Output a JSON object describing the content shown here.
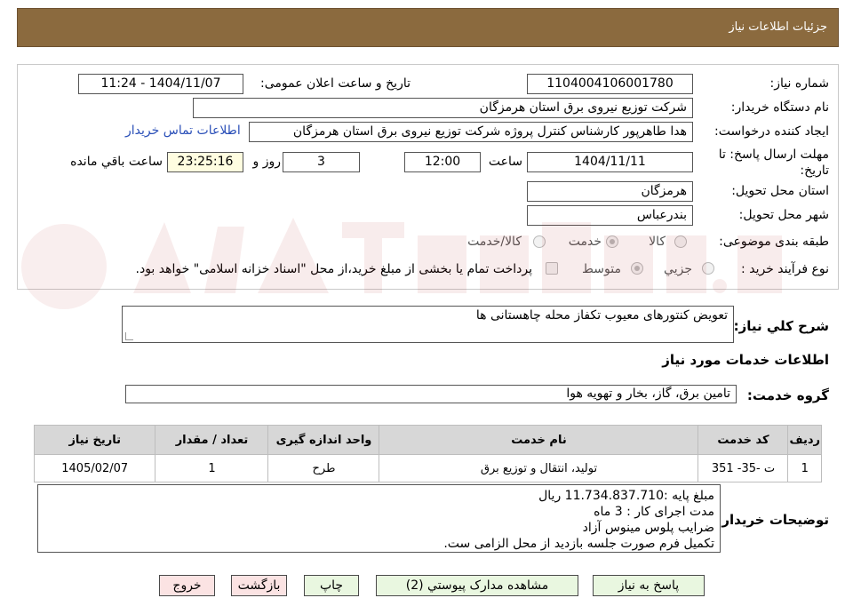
{
  "header": {
    "title": "جزئیات اطلاعات نیاز"
  },
  "form": {
    "need_number_label": "شماره نیاز:",
    "need_number": "1104004106001780",
    "announce_label": "تاریخ و ساعت اعلان عمومی:",
    "announce_value": "1404/11/07 - 11:24",
    "buyer_org_label": "نام دستگاه خریدار:",
    "buyer_org": "شرکت توزیع نیروی برق استان هرمزگان",
    "requester_label": "ایجاد کننده درخواست:",
    "requester": "هدا طاهرپور کارشناس کنترل پروژه شرکت توزیع نیروی برق استان هرمزگان",
    "contact_link": "اطلاعات تماس خریدار",
    "deadline_label_1": "مهلت ارسال پاسخ: تا",
    "deadline_label_2": "تاریخ:",
    "deadline_date": "1404/11/11",
    "time_label": "ساعت",
    "deadline_time": "12:00",
    "days": "3",
    "days_label": "روز و",
    "remaining_time": "23:25:16",
    "remaining_label": "ساعت باقي مانده",
    "province_label": "استان محل تحویل:",
    "province": "هرمزگان",
    "city_label": "شهر محل تحویل:",
    "city": "بندرعباس",
    "category_label": "طبقه بندی موضوعی:",
    "category_options": [
      "کالا",
      "خدمت",
      "کالا/خدمت"
    ],
    "category_selected": "خدمت",
    "process_label": "نوع فرآیند خرید :",
    "process_options": [
      "جزیي",
      "متوسط"
    ],
    "process_selected": "متوسط",
    "payment_note": "پرداخت تمام یا بخشی از مبلغ خرید،از محل \"اسناد خزانه اسلامی\" خواهد بود."
  },
  "summary": {
    "label": "شرح کلي نياز:",
    "text": "تعویض کنتورهای معیوب تکفاز محله چاهستانی ها"
  },
  "services": {
    "title": "اطلاعات خدمات مورد نیاز",
    "group_label": "گروه خدمت:",
    "group_value": "تامین برق، گاز، بخار و تهویه هوا",
    "columns": [
      "ردیف",
      "کد خدمت",
      "نام خدمت",
      "واحد اندازه گیری",
      "تعداد / مقدار",
      "تاریخ نیاز"
    ],
    "rows": [
      [
        "1",
        "ت -35- 351",
        "تولید، انتقال و توزیع برق",
        "طرح",
        "1",
        "1405/02/07"
      ]
    ]
  },
  "buyer_notes": {
    "label": "توضیحات خریدار:",
    "lines": [
      "مبلغ پایه :11.734.837.710 ریال",
      "مدت اجرای کار : 3 ماه",
      "ضرایب پلوس مینوس آزاد",
      "تکمیل فرم صورت جلسه بازدید از محل الزامی ست."
    ]
  },
  "buttons": {
    "reply": "پاسخ به نیاز",
    "attachments": "مشاهده مدارک پیوستي (2)",
    "print": "چاپ",
    "back": "بازگشت",
    "exit": "خروج"
  },
  "colors": {
    "header_bg": "#8b6a3e",
    "link": "#2a4fb8",
    "table_header_bg": "#d7d7d7",
    "green_button": "#e9f7e0",
    "pink_button": "#fbe3e3",
    "time_box": "#fffde0"
  }
}
